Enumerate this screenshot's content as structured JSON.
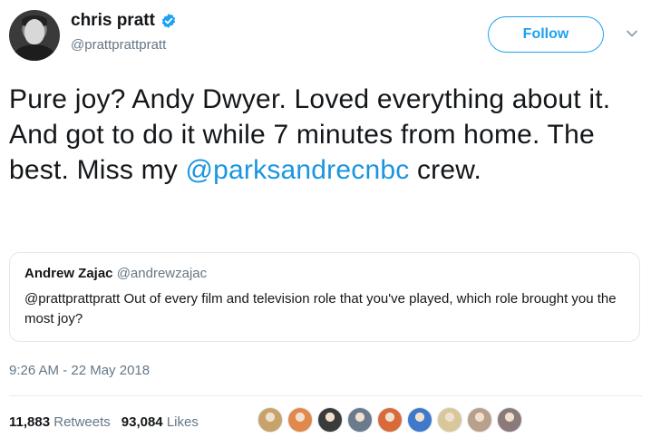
{
  "author": {
    "name": "chris pratt",
    "handle": "@prattprattpratt",
    "verified_icon": "verified-badge-icon"
  },
  "follow_label": "Follow",
  "tweet": {
    "text_1": "Pure joy? Andy Dwyer. Loved everything about it. And got to do it while 7 minutes from home. The best. Miss my ",
    "mention": "@parksandrecnbc",
    "text_2": " crew."
  },
  "quoted": {
    "name": "Andrew Zajac",
    "handle": "@andrewzajac",
    "text": "@prattprattpratt Out of every film and television role that you've played, which role brought you the most joy?"
  },
  "timestamp": "9:26 AM - 22 May 2018",
  "stats": {
    "retweets_count": "11,883",
    "retweets_label": "Retweets",
    "likes_count": "93,084",
    "likes_label": "Likes"
  },
  "likers": [
    {
      "color": "#c7a36a"
    },
    {
      "color": "#e0894a"
    },
    {
      "color": "#3b3b3b"
    },
    {
      "color": "#6b7a8c"
    },
    {
      "color": "#d96a3a"
    },
    {
      "color": "#3f79c9"
    },
    {
      "color": "#d9c79a"
    },
    {
      "color": "#b9a08a"
    },
    {
      "color": "#8c7a7a"
    }
  ],
  "colors": {
    "accent": "#1da1f2",
    "link": "#1b95e0",
    "muted": "#657786"
  }
}
